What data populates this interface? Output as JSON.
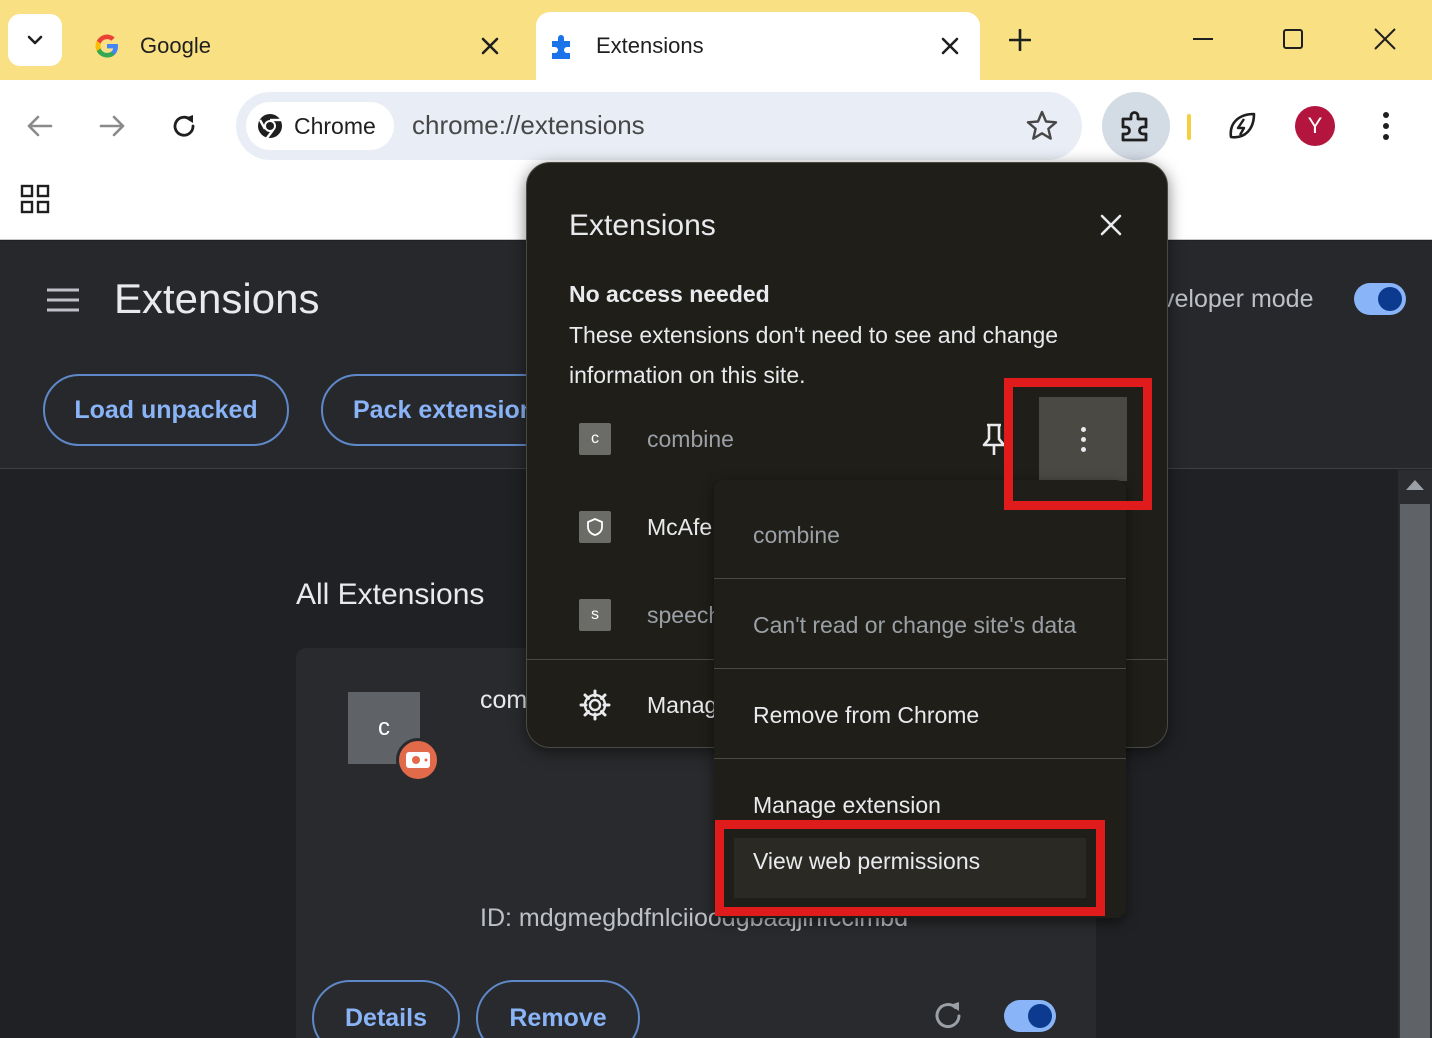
{
  "browser": {
    "tabs": [
      {
        "title": "Google",
        "active": false,
        "icon": "google-icon"
      },
      {
        "title": "Extensions",
        "active": true,
        "icon": "puzzle-icon"
      }
    ],
    "omnibox": {
      "chip_label": "Chrome",
      "url": "chrome://extensions"
    },
    "profile_initial": "Y"
  },
  "page": {
    "title": "Extensions",
    "developer_mode_label": "veloper mode",
    "developer_mode_on": true,
    "load_unpacked": "Load unpacked",
    "pack_extension": "Pack extension",
    "section_title": "All Extensions",
    "card": {
      "icon_letter": "c",
      "name": "com",
      "id": "ID: mdgmegbdfnlciioodgbaajjinfccimbd",
      "details": "Details",
      "remove": "Remove",
      "enabled": true
    }
  },
  "popup": {
    "title": "Extensions",
    "section_heading": "No access needed",
    "section_desc": "These extensions don't need to see and change information on this site.",
    "extensions": [
      {
        "letter": "c",
        "name": "combine"
      },
      {
        "letter": "",
        "name": "McAfe"
      },
      {
        "letter": "s",
        "name": "speech"
      }
    ],
    "manage_label": "Manag"
  },
  "menu": {
    "header": "combine",
    "access": "Can't read or change site's data",
    "remove": "Remove from Chrome",
    "manage": "Manage extension",
    "view_permissions": "View web permissions"
  },
  "colors": {
    "tabstrip": "#f8e083",
    "popup_bg": "#1f1e19",
    "highlight": "#e01b1b",
    "accent_blue": "#8ab4f8"
  }
}
